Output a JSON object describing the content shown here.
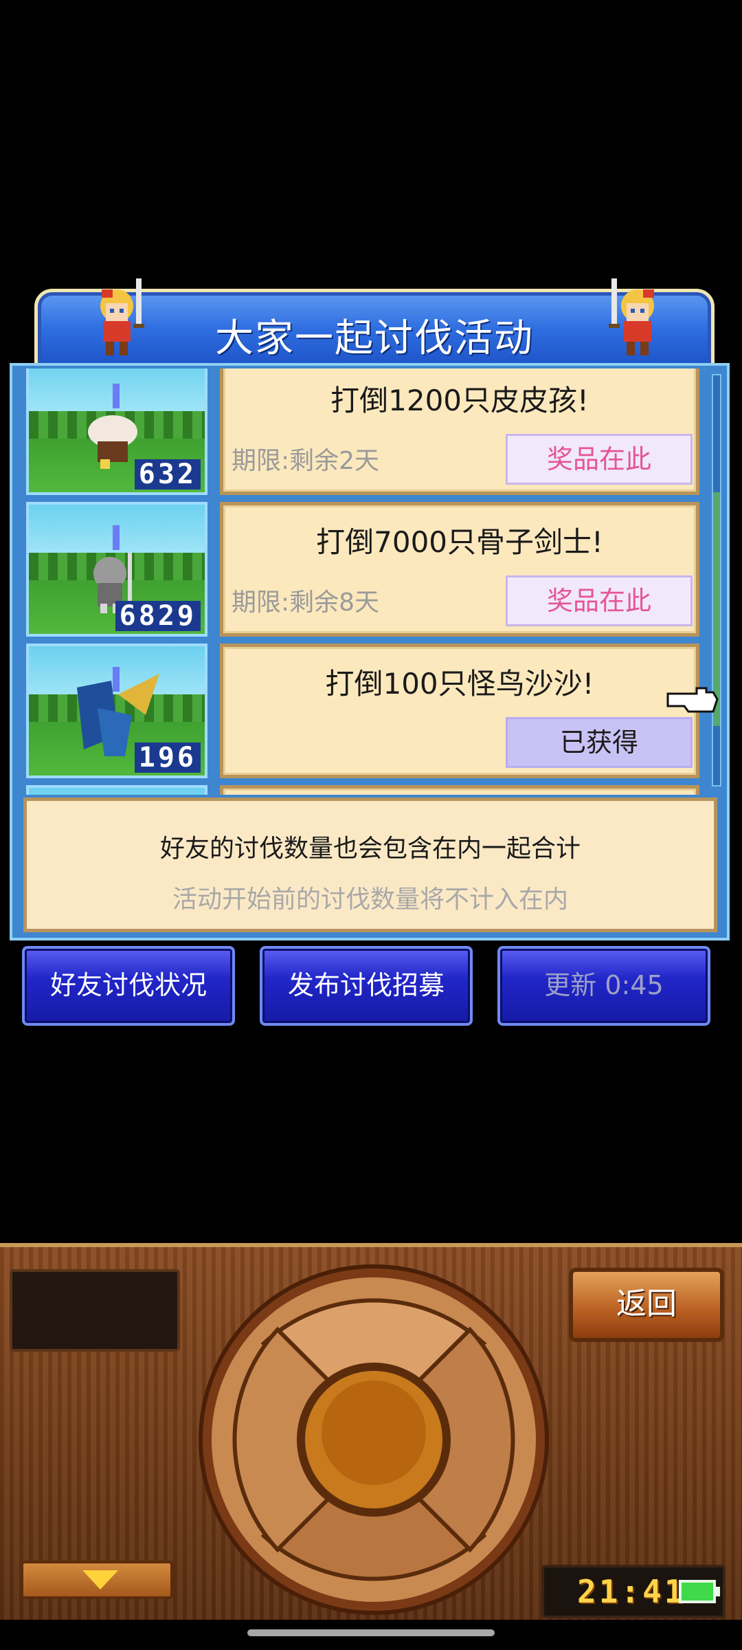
{
  "dialog": {
    "title": "大家一起讨伐活动",
    "quests": [
      {
        "count": "632",
        "goal": "打倒1200只皮皮孩!",
        "deadline": "期限:剩余2天",
        "button": "奖品在此",
        "claimed": false,
        "monster": "mushroom-kid-monster-icon"
      },
      {
        "count": "6829",
        "goal": "打倒7000只骨子剑士!",
        "deadline": "期限:剩余8天",
        "button": "奖品在此",
        "claimed": false,
        "monster": "skeleton-swordsman-monster-icon"
      },
      {
        "count": "196",
        "goal": "打倒100只怪鸟沙沙!",
        "deadline": "",
        "button": "已获得",
        "claimed": true,
        "monster": "strange-bird-monster-icon"
      }
    ],
    "info_main": "好友的讨伐数量也会包含在内一起合计",
    "info_sub": "活动开始前的讨伐数量将不计入在内"
  },
  "buttons": {
    "friend_status": "好友讨伐状况",
    "post_recruit": "发布讨伐招募",
    "refresh": "更新 0:45"
  },
  "controller": {
    "back": "返回",
    "clock": "21:41"
  },
  "colors": {
    "title_blue": "#2f6ee0",
    "card_bg": "#fbe8bd",
    "prize_text": "#e45598",
    "claimed_bg": "#c9c3f5",
    "button_blue": "#2126c8",
    "clock_yellow": "#ffd34a"
  }
}
